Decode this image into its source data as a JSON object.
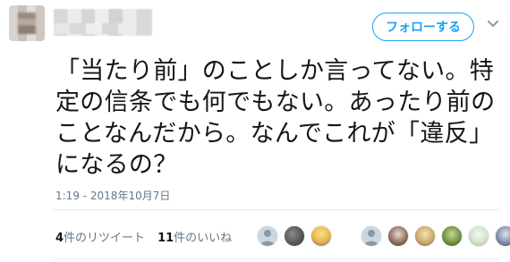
{
  "header": {
    "follow_label": "フォローする"
  },
  "tweet": {
    "text": "「当たり前」のことしか言ってない。特定の信条でも何でもない。あったり前のことなんだから。なんでこれが「違反」になるの？"
  },
  "meta": {
    "timestamp": "1:19 - 2018年10月7日"
  },
  "stats": {
    "retweets_count": "4",
    "retweets_label": "件のリツイート",
    "likes_count": "11",
    "likes_label": "件のいいね"
  },
  "avatar_colors": {
    "group1": [
      "#ccd6dd",
      "#4a4a4a",
      "#e6b84a"
    ],
    "group2": [
      "#ccd6dd",
      "#8c6a5a",
      "#c9a56b",
      "#6b8f3a",
      "#cfe0c8",
      "#7a8aa6"
    ]
  },
  "colors": {
    "accent": "#1da1f2",
    "text": "#14171a",
    "muted": "#657786"
  }
}
